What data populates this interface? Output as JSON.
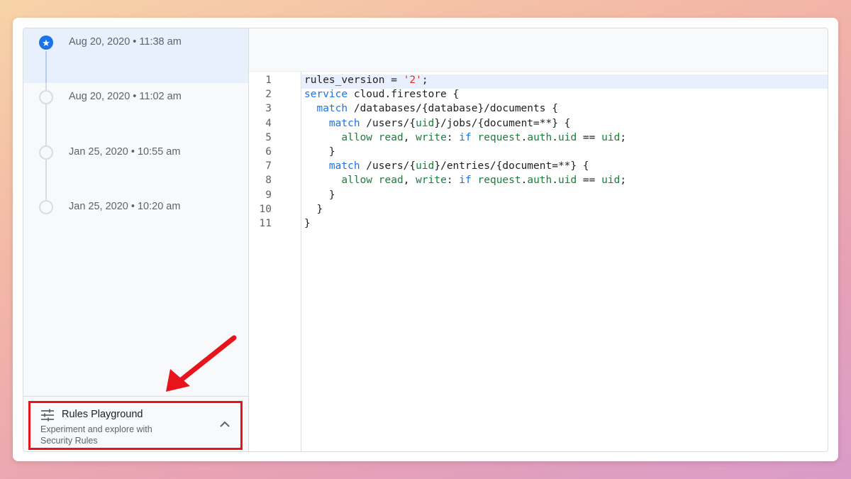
{
  "sidebar": {
    "versions": [
      {
        "label": "Aug 20, 2020 • 11:38 am",
        "active": true
      },
      {
        "label": "Aug 20, 2020 • 11:02 am",
        "active": false
      },
      {
        "label": "Jan 25, 2020 • 10:55 am",
        "active": false
      },
      {
        "label": "Jan 25, 2020 • 10:20 am",
        "active": false
      }
    ],
    "playground": {
      "title": "Rules Playground",
      "description": "Experiment and explore with Security Rules",
      "icon": "tune-icon",
      "toggle_icon": "chevron-up-icon"
    }
  },
  "editor": {
    "lines": [
      {
        "num": "1",
        "code": "rules_version = '2';"
      },
      {
        "num": "2",
        "code": "service cloud.firestore {"
      },
      {
        "num": "3",
        "code": "  match /databases/{database}/documents {"
      },
      {
        "num": "4",
        "code": "    match /users/{uid}/jobs/{document=**} {"
      },
      {
        "num": "5",
        "code": "      allow read, write: if request.auth.uid == uid;"
      },
      {
        "num": "6",
        "code": "    }"
      },
      {
        "num": "7",
        "code": "    match /users/{uid}/entries/{document=**} {"
      },
      {
        "num": "8",
        "code": "      allow read, write: if request.auth.uid == uid;"
      },
      {
        "num": "9",
        "code": "    }"
      },
      {
        "num": "10",
        "code": "  }"
      },
      {
        "num": "11",
        "code": "}"
      }
    ]
  },
  "colors": {
    "accent": "#1a73e8",
    "highlight_box": "#e8141c",
    "annotation_arrow": "#e8141c"
  }
}
